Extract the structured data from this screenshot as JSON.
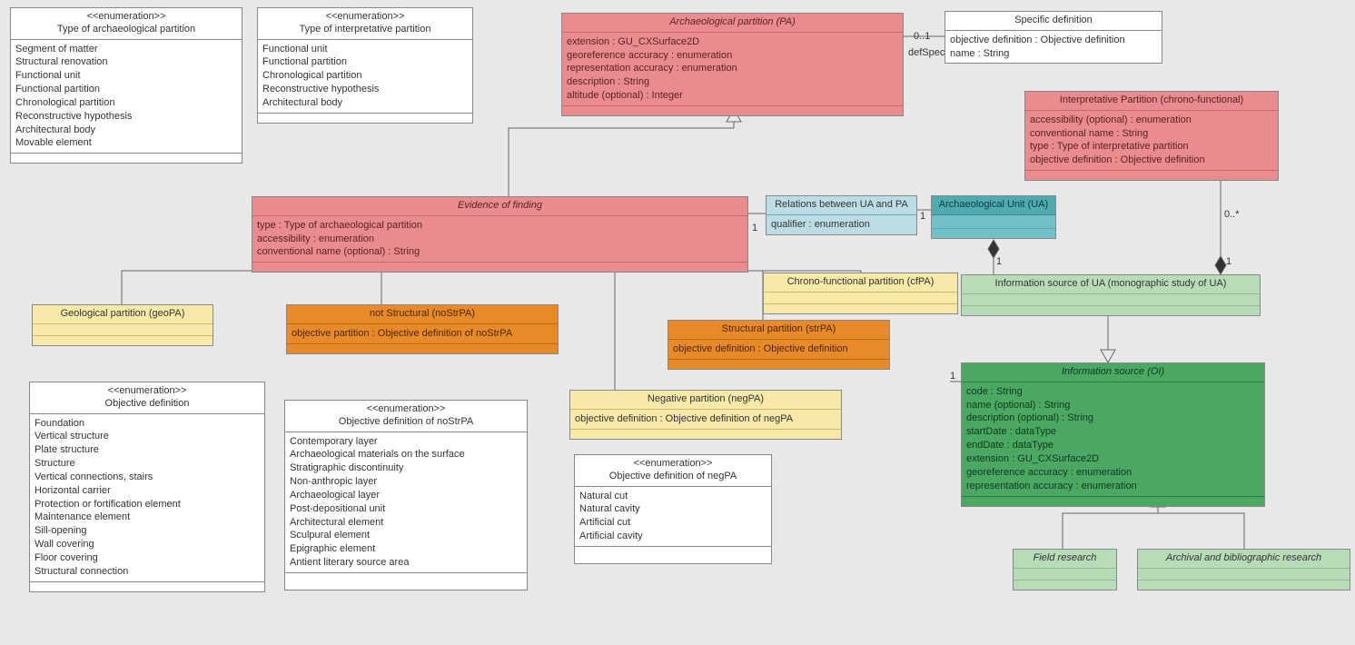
{
  "enum_arch_partition": {
    "stereo": "<<enumeration>>",
    "name": "Type of archaeological partition",
    "items": [
      "Segment of matter",
      "Structural renovation",
      "Functional unit",
      "Functional partition",
      "Chronological partition",
      "Reconstructive hypothesis",
      "Architectural body",
      "Movable element"
    ]
  },
  "enum_interp_partition": {
    "stereo": "<<enumeration>>",
    "name": "Type of interpretative partition",
    "items": [
      "Functional unit",
      "Functional partition",
      "Chronological partition",
      "Reconstructive hypothesis",
      "Architectural body"
    ]
  },
  "arch_partition_pa": {
    "name": "Archaeological partition (PA)",
    "attrs": [
      "extension : GU_CXSurface2D",
      "georeference accuracy : enumeration",
      "representation accuracy : enumeration",
      "description : String",
      "altitude (optional) : Integer"
    ]
  },
  "specific_def": {
    "name": "Specific definition",
    "attrs": [
      "objective definition : Objective definition",
      "name : String"
    ]
  },
  "interp_partition": {
    "name": "Interpretative Partition (chrono-functional)",
    "attrs": [
      "accessibility (optional) : enumeration",
      "conventional name : String",
      "type : Type of interpretative partition",
      "objective definition : Objective definition"
    ]
  },
  "evidence_finding": {
    "name": "Evidence of finding",
    "attrs": [
      "type : Type of archaeological partition",
      "accessibility : enumeration",
      "conventional name (optional) : String"
    ]
  },
  "relations_ua_pa": {
    "name": "Relations between UA and PA",
    "attrs": [
      "qualifier : enumeration"
    ]
  },
  "arch_unit_ua": {
    "name": "Archaeological Unit (UA)"
  },
  "geo_partition": {
    "name": "Geological partition (geoPA)"
  },
  "not_structural": {
    "name": "not Structural (noStrPA)",
    "attrs": [
      "objective partition : Objective definition of noStrPA"
    ]
  },
  "chrono_func": {
    "name": "Chrono-functional partition (cfPA)"
  },
  "structural_partition": {
    "name": "Structural partition (strPA)",
    "attrs": [
      "objective definition : Objective definition"
    ]
  },
  "negative_partition": {
    "name": "Negative partition (negPA)",
    "attrs": [
      "objective definition : Objective definition of negPA"
    ]
  },
  "info_source_ua": {
    "name": "Information source of UA (monographic study of UA)"
  },
  "info_source_oi": {
    "name": "Information source (OI)",
    "attrs": [
      "code : String",
      "name (optional) : String",
      "description (optional) : String",
      "startDate : dataType",
      "endDate : dataType",
      "extension : GU_CXSurface2D",
      "georeference accuracy : enumeration",
      "representation accuracy : enumeration"
    ]
  },
  "field_research": {
    "name": "Field research"
  },
  "archival_research": {
    "name": "Archival and bibliographic research"
  },
  "enum_obj_def": {
    "stereo": "<<enumeration>>",
    "name": "Objective definition",
    "items": [
      "Foundation",
      "Vertical structure",
      "Plate structure",
      "Structure",
      "Vertical connections, stairs",
      "Horizontal carrier",
      "Protection or fortification element",
      "Maintenance element",
      "Sill-opening",
      "Wall covering",
      "Floor covering",
      "Structural connection"
    ]
  },
  "enum_nostrpa": {
    "stereo": "<<enumeration>>",
    "name": "Objective definition of noStrPA",
    "items": [
      "Contemporary layer",
      "Archaeological materials on the surface",
      "Stratigraphic discontinuity",
      "Non-anthropic layer",
      "Archaeological layer",
      "Post-depositional unit",
      "Architectural element",
      "Sculpural element",
      "Epigraphic element",
      "Antient literary source area"
    ]
  },
  "enum_negpa": {
    "stereo": "<<enumeration>>",
    "name": "Objective definition of negPA",
    "items": [
      "Natural cut",
      "Natural cavity",
      "Artificial cut",
      "Artificial cavity"
    ]
  },
  "labels": {
    "defSpec": "defSpec",
    "m01": "0..1",
    "m1a": "1",
    "m1b": "1",
    "m1c": "1",
    "m1d": "1",
    "m1e": "1",
    "m0s": "0..*"
  }
}
